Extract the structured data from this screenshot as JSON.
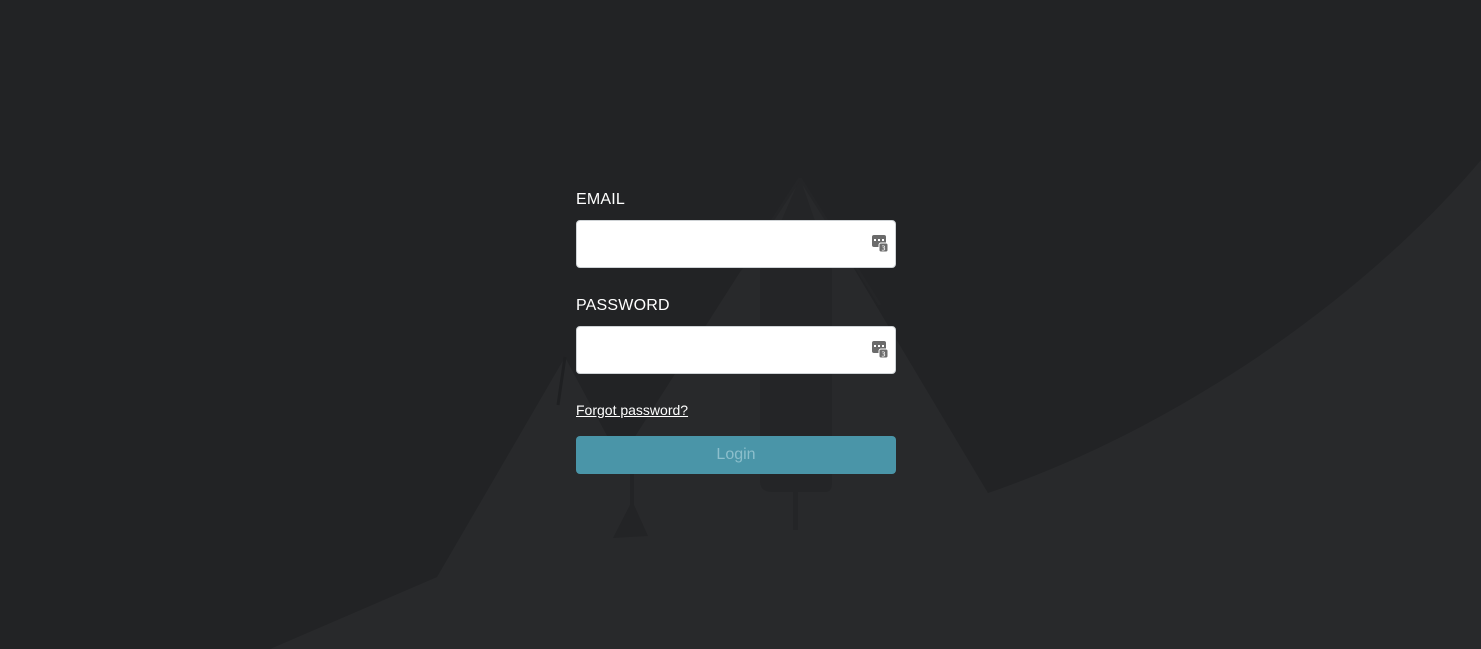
{
  "form": {
    "email": {
      "label": "EMAIL",
      "value": "",
      "placeholder": ""
    },
    "password": {
      "label": "PASSWORD",
      "value": "",
      "placeholder": ""
    },
    "forgot_link": "Forgot password?",
    "login_label": "Login"
  },
  "icons": {
    "password_manager": "password-manager-icon",
    "background": "rocket-mountain-illustration"
  },
  "colors": {
    "background": "#222325",
    "input_background": "#ffffff",
    "button_background": "#4a95a8",
    "button_text": "#8cbfcc",
    "label_text": "#ffffff"
  }
}
